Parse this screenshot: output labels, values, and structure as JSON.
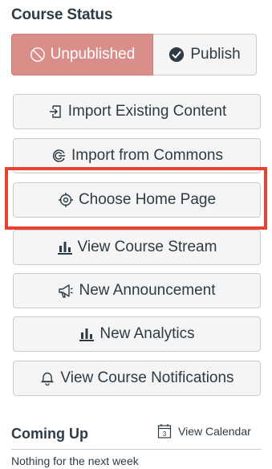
{
  "course_status": {
    "title": "Course Status",
    "unpublished_label": "Unpublished",
    "publish_label": "Publish",
    "unpublished_color": "#d98e8a"
  },
  "actions": {
    "import_existing": {
      "label": "Import Existing Content",
      "icon": "import-icon"
    },
    "import_commons": {
      "label": "Import from Commons",
      "icon": "commons-icon"
    },
    "choose_home": {
      "label": "Choose Home Page",
      "icon": "target-icon"
    },
    "view_stream": {
      "label": "View Course Stream",
      "icon": "bar-chart-icon"
    },
    "new_announcement": {
      "label": "New Announcement",
      "icon": "megaphone-icon"
    },
    "new_analytics": {
      "label": "New Analytics",
      "icon": "bar-chart-icon"
    },
    "view_notifications": {
      "label": "View Course Notifications",
      "icon": "bell-icon"
    }
  },
  "highlight_color": "#e8432f",
  "coming_up": {
    "title": "Coming Up",
    "view_calendar_label": "View Calendar",
    "calendar_day": "3",
    "empty_message": "Nothing for the next week"
  }
}
